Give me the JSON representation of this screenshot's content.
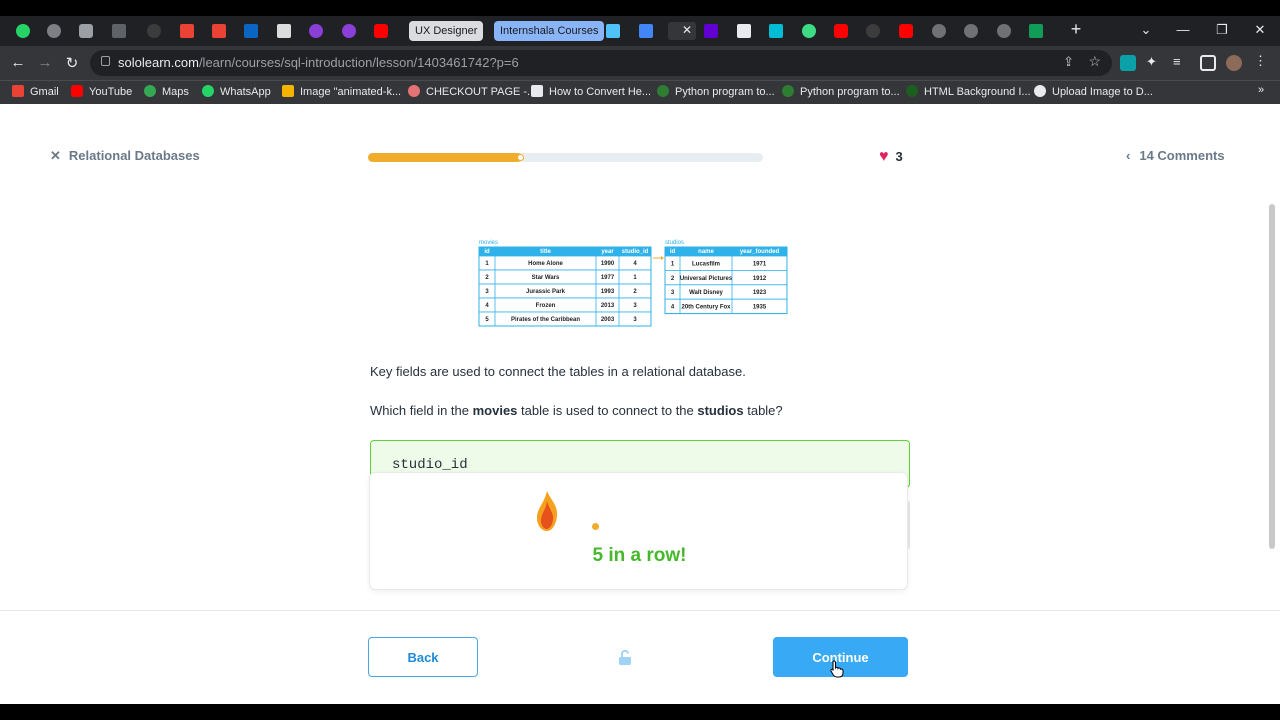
{
  "browser": {
    "tabs": {
      "ux_designer": "UX Designer",
      "internshala": "Internshala Courses"
    },
    "url_host": "sololearn.com",
    "url_path": "/learn/courses/sql-introduction/lesson/1403461742?p=6",
    "bookmarks": [
      "Gmail",
      "YouTube",
      "Maps",
      "WhatsApp",
      "Image \"animated-k...",
      "CHECKOUT PAGE -...",
      "How to Convert He...",
      "Python program to...",
      "Python program to...",
      "HTML Background I...",
      "Upload Image to D..."
    ],
    "bookmarks_more": "»"
  },
  "lesson": {
    "close_label": "Relational Databases",
    "progress": 0.39,
    "hearts": "3",
    "comments": "14 Comments"
  },
  "diagram": {
    "movies": {
      "caption": "movies",
      "headers": [
        "id",
        "title",
        "year",
        "studio_id"
      ],
      "rows": [
        [
          "1",
          "Home Alone",
          "1990",
          "4"
        ],
        [
          "2",
          "Star Wars",
          "1977",
          "1"
        ],
        [
          "3",
          "Jurassic Park",
          "1993",
          "2"
        ],
        [
          "4",
          "Frozen",
          "2013",
          "3"
        ],
        [
          "5",
          "Pirates of the Caribbean",
          "2003",
          "3"
        ]
      ]
    },
    "studios": {
      "caption": "studios",
      "headers": [
        "id",
        "name",
        "year_founded"
      ],
      "rows": [
        [
          "1",
          "Lucasfilm",
          "1971"
        ],
        [
          "2",
          "Universal Pictures",
          "1912"
        ],
        [
          "3",
          "Walt Disney",
          "1923"
        ],
        [
          "4",
          "20th Century Fox",
          "1935"
        ]
      ]
    },
    "colors": {
      "header": "#2fb2ea",
      "border": "#2fb2ea",
      "arrow": "#f0ac2c"
    }
  },
  "content": {
    "intro": "Key fields are used to connect the tables in a relational database.",
    "question_prefix": "Which field in the ",
    "question_bold1": "movies",
    "question_mid": " table is used to connect to the ",
    "question_bold2": "studios",
    "question_suffix": " table?",
    "answer": "studio_id",
    "streak": "5 in a row!"
  },
  "footer": {
    "back": "Back",
    "continue": "Continue"
  }
}
